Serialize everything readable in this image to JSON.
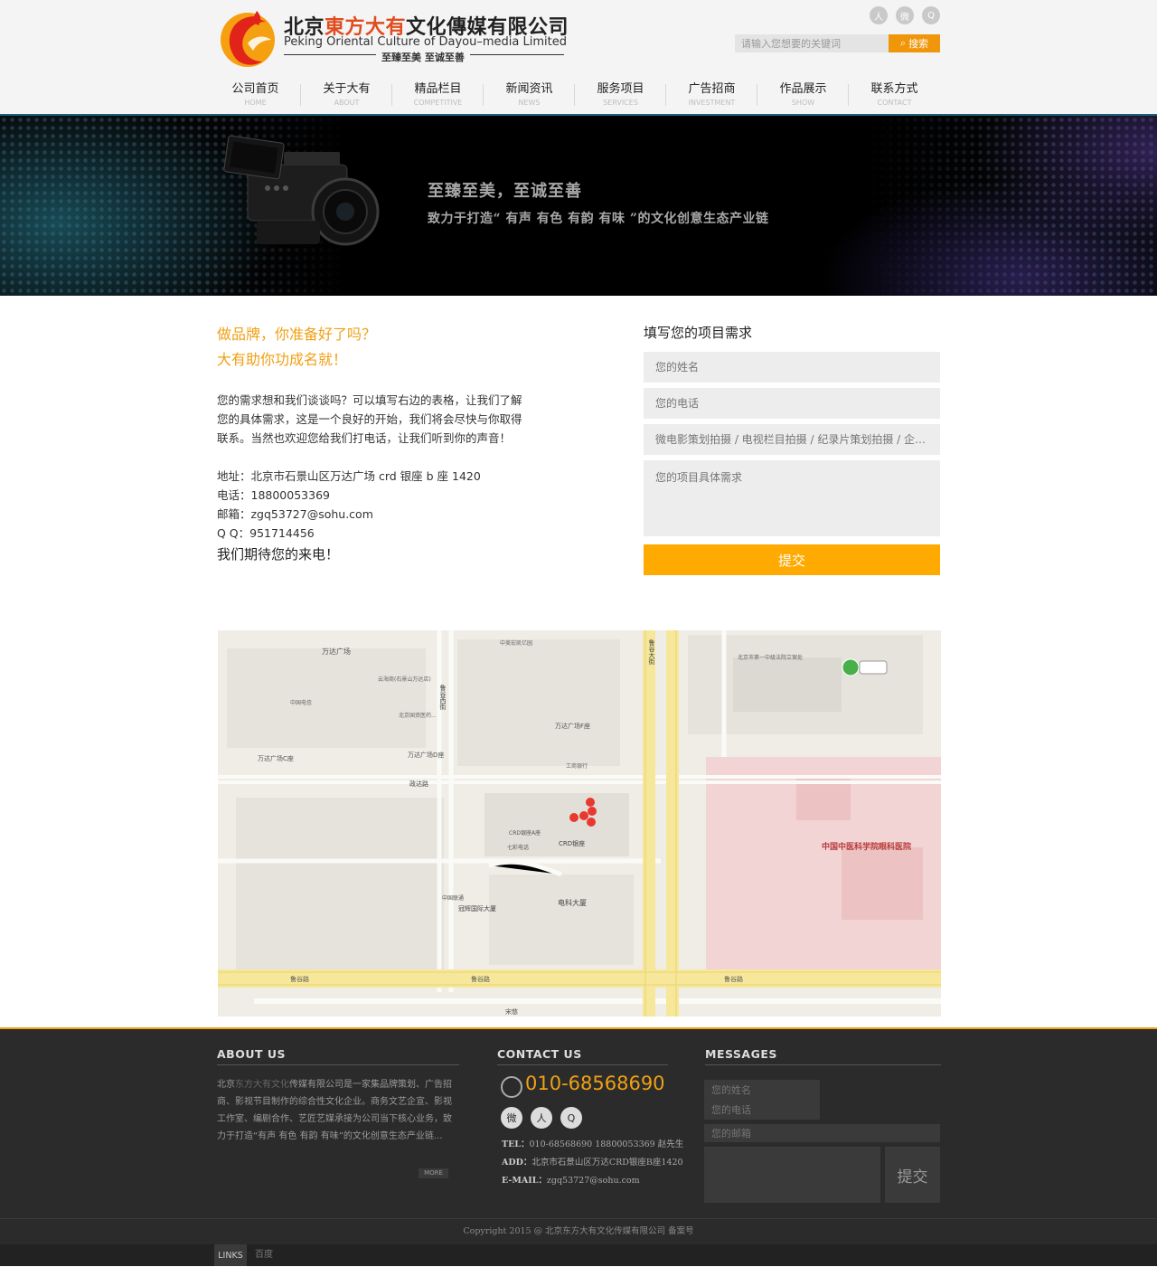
{
  "brand": {
    "name_pre": "北京",
    "name_hl": "東方大有",
    "name_post": "文化傳媒有限公司",
    "name_en": "Peking Oriental Culture of Dayou–media Limited",
    "slogan": "至臻至美  至诚至善"
  },
  "header": {
    "social": [
      "renren-icon",
      "weibo-icon",
      "qq-icon"
    ],
    "search": {
      "placeholder": "请输入您想要的关键词",
      "button_label": "搜索"
    }
  },
  "nav": [
    {
      "cn": "公司首页",
      "en": "HOME"
    },
    {
      "cn": "关于大有",
      "en": "ABOUT"
    },
    {
      "cn": "精品栏目",
      "en": "COMPETITIVE"
    },
    {
      "cn": "新闻资讯",
      "en": "NEWS"
    },
    {
      "cn": "服务项目",
      "en": "SERVICES"
    },
    {
      "cn": "广告招商",
      "en": "INVESTMENT"
    },
    {
      "cn": "作品展示",
      "en": "SHOW"
    },
    {
      "cn": "联系方式",
      "en": "CONTACT"
    }
  ],
  "banner": {
    "line1": "至臻至美，至诚至善",
    "line2": "致力于打造“ 有声 有色 有韵 有味 ”的文化创意生态产业链"
  },
  "intro": {
    "heading1": "做品牌，你准备好了吗？",
    "heading2": "大有助你功成名就！",
    "paragraph": "您的需求想和我们谈谈吗？可以填写右边的表格，让我们了解您的具体需求，这是一个良好的开始，我们将会尽快与你取得联系。当然也欢迎您给我们打电话，让我们听到你的声音！",
    "address": "地址：北京市石景山区万达广场 crd 银座 b 座 1420",
    "phone": "电话：18800053369",
    "email": "邮箱：zgq53727@sohu.com",
    "qq": "Q Q：951714456",
    "closing": "我们期待您的来电！"
  },
  "form": {
    "title": "填写您的项目需求",
    "name_placeholder": "您的姓名",
    "phone_placeholder": "您的电话",
    "service_placeholder": "微电影策划拍摄 / 电视栏目拍摄 / 纪录片策划拍摄 / 企业 ...",
    "detail_placeholder": "您的项目具体需求",
    "submit_label": "提交"
  },
  "map": {
    "places": [
      "万达广场",
      "云海商(石景山万达店)",
      "北京市第一中级法院立案处",
      "中美宏凯亿园",
      "工商银行",
      "中国电信",
      "北京国资医药...",
      "万达广场F座",
      "中国工商银行",
      "万达广场C座",
      "万达广场D座",
      "政达路",
      "鲁谷西街",
      "鲁谷大街",
      "中国中医科学院眼科医院",
      "CRD银座A座",
      "CRD银座",
      "七彩电话",
      "中国联通",
      "冠辉国际大厦",
      "电科大厦",
      "鲁谷路",
      "宋慈"
    ],
    "colors": {
      "road": "#f7f7f4",
      "main_road": "#f6e79a",
      "block": "#e9e6df",
      "hospital": "#f3d4d4",
      "marker": "#e8392e"
    }
  },
  "footer": {
    "about": {
      "title": "ABOUT US",
      "text_pre": "北京",
      "text_dim": "东方大有文化",
      "text_post": "传媒有限公司是一家集品牌策划、广告招商、影视节目制作的综合性文化企业。商务文艺企宣、影视工作室、编剧合作、艺匠艺媒承接为公司当下核心业务，致力于打造“有声 有色 有韵 有味”的文化创意生态产业链...",
      "more": "MORE"
    },
    "contact": {
      "title": "CONTACT US",
      "phone": "010-68568690",
      "social": [
        "weibo-icon",
        "renren-icon",
        "qq-icon"
      ],
      "tel_label": "TEL：",
      "tel": "010-68568690 18800053369 赵先生",
      "addr_label": "ADD：",
      "addr": "北京市石景山区万达CRD银座B座1420",
      "email_label": "E-MAIL：",
      "email": "zgq53727@sohu.com"
    },
    "messages": {
      "title": "MESSAGES",
      "name_placeholder": "您的姓名",
      "phone_placeholder": "您的电话",
      "email_placeholder": "您的邮箱",
      "submit_label": "提交"
    },
    "copyright": "Copyright 2015 @ 北京东方大有文化传媒有限公司   备案号",
    "links_label": "LINKS",
    "links": [
      "百度"
    ]
  },
  "accent": "#f0a014"
}
